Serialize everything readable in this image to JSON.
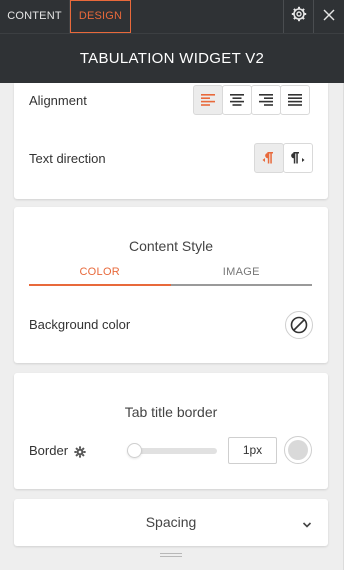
{
  "topbar": {
    "tab_content": "CONTENT",
    "tab_design": "DESIGN",
    "gear_icon": "gear-icon",
    "close_icon": "close-icon"
  },
  "widget_title": "TABULATION WIDGET V2",
  "layout_section": {
    "alignment_label": "Alignment",
    "alignment_options": [
      "align-left-icon",
      "align-center-icon",
      "align-right-icon",
      "align-justify-icon"
    ],
    "alignment_selected": "align-left",
    "text_direction_label": "Text direction",
    "text_direction_options": [
      "ltr-icon",
      "rtl-icon"
    ],
    "text_direction_selected": "ltr"
  },
  "content_style": {
    "title": "Content Style",
    "tabs": [
      "COLOR",
      "IMAGE"
    ],
    "active_tab": "COLOR",
    "background_color_label": "Background color",
    "background_color_value": "none"
  },
  "tab_title_border": {
    "title": "Tab title border",
    "border_label": "Border",
    "border_value": "1px",
    "slider_level": 0,
    "border_color": "#d9d9d9"
  },
  "spacing": {
    "label": "Spacing"
  },
  "colors": {
    "accent": "#e8693b",
    "topbar": "#2f3235",
    "panel_bg": "#eeeeee"
  }
}
